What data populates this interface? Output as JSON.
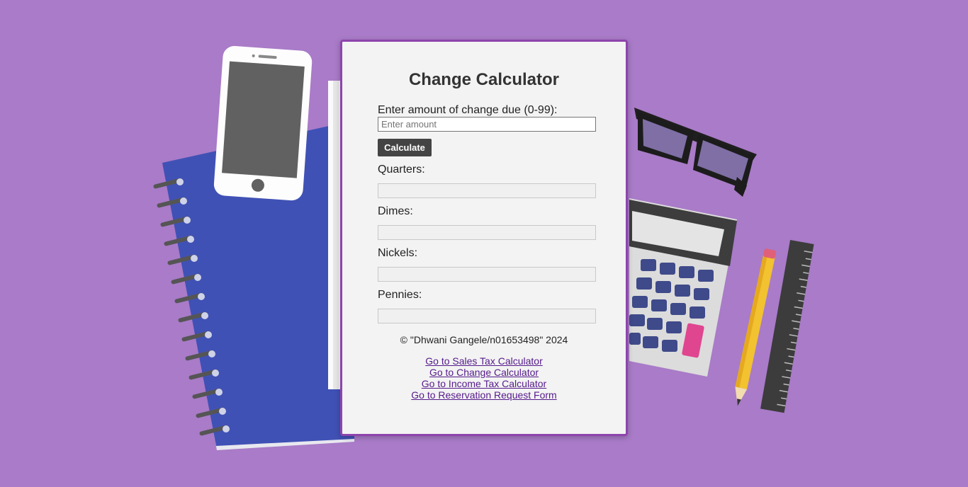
{
  "page": {
    "title": "Change Calculator"
  },
  "form": {
    "amount_label": "Enter amount of change due (0-99):",
    "amount_placeholder": "Enter amount",
    "amount_value": "",
    "calculate_label": "Calculate"
  },
  "outputs": {
    "quarters_label": "Quarters:",
    "dimes_label": "Dimes:",
    "nickels_label": "Nickels:",
    "pennies_label": "Pennies:",
    "quarters_value": "",
    "dimes_value": "",
    "nickels_value": "",
    "pennies_value": ""
  },
  "footer": {
    "copyright": "© \"Dhwani Gangele/n01653498\" 2024"
  },
  "links": [
    {
      "label": "Go to Sales Tax Calculator"
    },
    {
      "label": "Go to Change Calculator"
    },
    {
      "label": "Go to Income Tax Calculator"
    },
    {
      "label": "Go to Reservation Request Form"
    }
  ],
  "colors": {
    "background": "#a97bc8",
    "card": "#f3f3f3",
    "card_border": "#8e44ad",
    "button": "#444444",
    "link": "#551a8b",
    "notebook": "#4051b5"
  },
  "icons": [
    "notebook-illustration",
    "phone-illustration",
    "glasses-illustration",
    "calculator-illustration",
    "pencil-illustration",
    "ruler-illustration"
  ]
}
